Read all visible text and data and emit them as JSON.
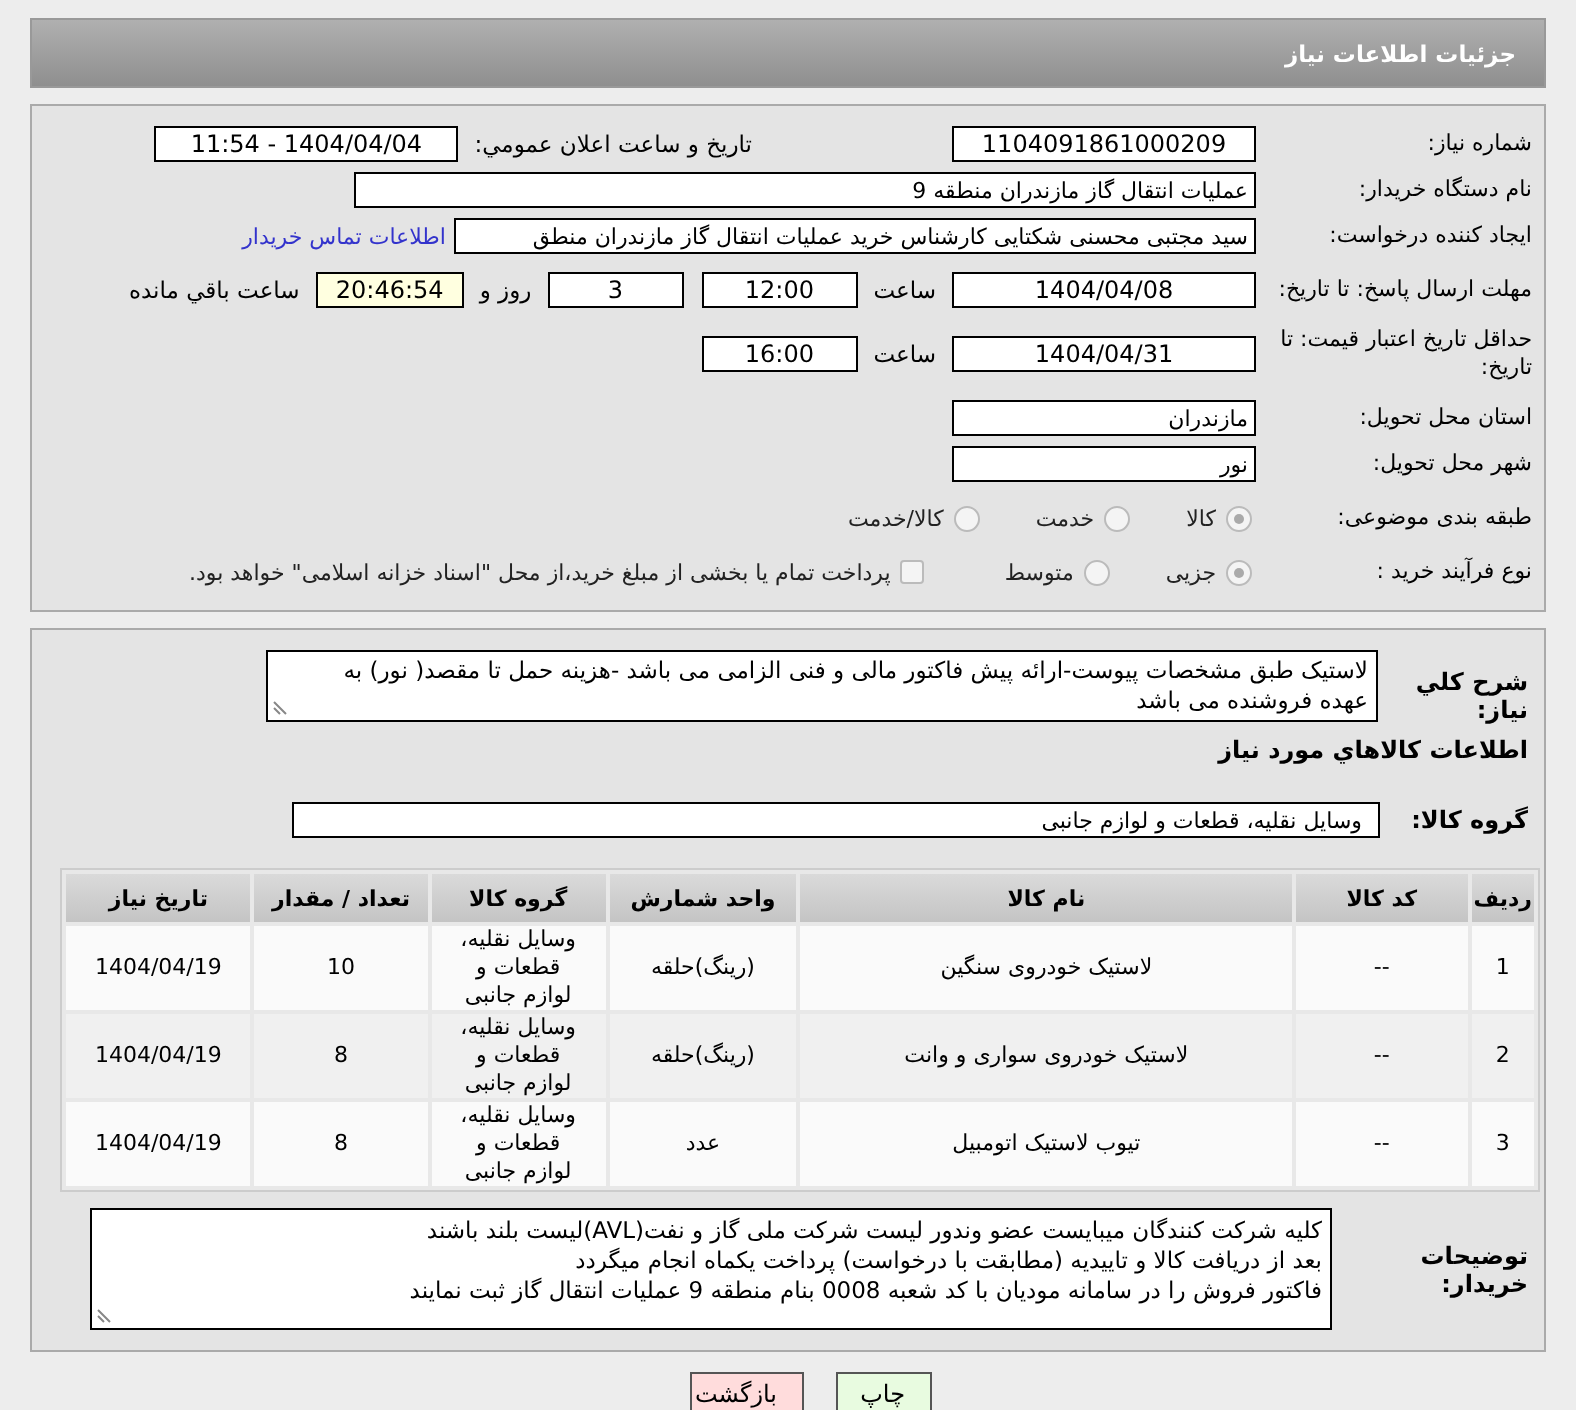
{
  "header": {
    "title": "جزئیات اطلاعات نیاز"
  },
  "need_number": {
    "label": "شماره نیاز:",
    "value": "1104091861000209"
  },
  "announce": {
    "label": "تاریخ و ساعت اعلان عمومي:",
    "value": "1404/04/04 - 11:54"
  },
  "buyer_org": {
    "label": "نام دستگاه خریدار:",
    "value": "عملیات انتقال گاز مازندران منطقه 9"
  },
  "creator": {
    "label": "ایجاد کننده درخواست:",
    "value": "سید مجتبی محسنی شکتایی کارشناس خرید عملیات انتقال گاز مازندران منطق",
    "link": "اطلاعات تماس خریدار"
  },
  "deadline": {
    "label": "مهلت ارسال پاسخ: تا تاریخ:",
    "date": "1404/04/08",
    "time_label": "ساعت",
    "time": "12:00",
    "days": "3",
    "days_label": "روز و",
    "remaining": "20:46:54",
    "remaining_label": "ساعت باقي مانده"
  },
  "validity": {
    "label": "حداقل تاریخ اعتبار قیمت: تا تاریخ:",
    "date": "1404/04/31",
    "time_label": "ساعت",
    "time": "16:00"
  },
  "province": {
    "label": "استان محل تحویل:",
    "value": "مازندران"
  },
  "city": {
    "label": "شهر محل تحویل:",
    "value": "نور"
  },
  "category": {
    "label": "طبقه بندی موضوعی:",
    "options": [
      {
        "label": "کالا",
        "selected": true
      },
      {
        "label": "خدمت",
        "selected": false
      },
      {
        "label": "کالا/خدمت",
        "selected": false
      }
    ]
  },
  "process": {
    "label": "نوع فرآیند خرید :",
    "options": [
      {
        "label": "جزیی",
        "selected": true
      },
      {
        "label": "متوسط",
        "selected": false
      }
    ],
    "treasury": {
      "label": "پرداخت تمام یا بخشی از مبلغ خرید،از محل \"اسناد خزانه اسلامی\" خواهد بود.",
      "checked": false
    }
  },
  "description": {
    "label": "شرح کلي نیاز:",
    "value": "لاستیک طبق مشخصات پیوست-ارائه پیش فاکتور مالی و فنی الزامی می باشد -هزینه حمل تا مقصد( نور) به عهده فروشنده می باشد"
  },
  "goods_title": "اطلاعات کالاهاي مورد نیاز",
  "goods_group": {
    "label": "گروه کالا:",
    "value": "وسایل نقلیه، قطعات و لوازم جانبی"
  },
  "table": {
    "columns": [
      "ردیف",
      "کد کالا",
      "نام کالا",
      "واحد شمارش",
      "گروه کالا",
      "تعداد / مقدار",
      "تاریخ نیاز"
    ],
    "rows": [
      [
        "1",
        "--",
        "لاستیک خودروی سنگین",
        "(رینگ)حلقه",
        "وسایل نقلیه، قطعات و لوازم جانبی",
        "10",
        "1404/04/19"
      ],
      [
        "2",
        "--",
        "لاستیک خودروی سواری و وانت",
        "(رینگ)حلقه",
        "وسایل نقلیه، قطعات و لوازم جانبی",
        "8",
        "1404/04/19"
      ],
      [
        "3",
        "--",
        "تیوب لاستیک اتومبیل",
        "عدد",
        "وسایل نقلیه، قطعات و لوازم جانبی",
        "8",
        "1404/04/19"
      ]
    ]
  },
  "buyer_notes": {
    "label": "توضیحات خریدار:",
    "lines": [
      "کلیه شرکت کنندگان میبایست عضو وندور لیست شرکت ملی گاز و نفت(AVL)لیست بلند باشند",
      "بعد از دریافت کالا و تاییدیه (مطابقت با درخواست) پرداخت یکماه انجام میگردد",
      "فاکتور فروش را در سامانه مودیان با کد شعبه 0008 بنام منطقه 9 عملیات انتقال گاز ثبت نمایند"
    ]
  },
  "buttons": [
    {
      "label": "چاپ",
      "kind": "print"
    },
    {
      "label": "بازگشت",
      "kind": "back"
    }
  ]
}
